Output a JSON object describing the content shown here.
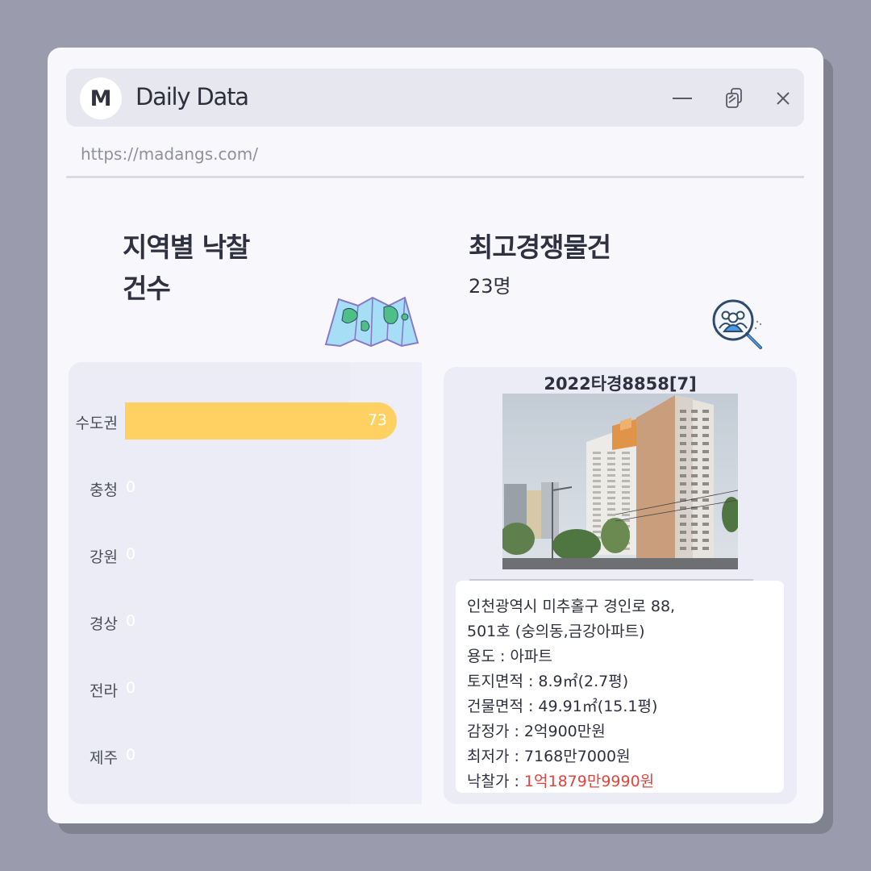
{
  "window": {
    "logo": "M",
    "title": "Daily Data",
    "url": "https://madangs.com/",
    "controls": [
      "minimize-icon",
      "restore-icon",
      "close-icon"
    ]
  },
  "left_card": {
    "title_line1": "지역별 낙찰",
    "title_line2": "건수",
    "icon": "map-icon",
    "chart_data": {
      "type": "bar",
      "orientation": "horizontal",
      "categories": [
        "수도권",
        "충청",
        "강원",
        "경상",
        "전라",
        "제주"
      ],
      "values": [
        73,
        0,
        0,
        0,
        0,
        0
      ],
      "xlim": [
        0,
        73
      ]
    }
  },
  "right_card": {
    "title": "최고경쟁물건",
    "subtitle": "23명",
    "icon": "people-search-icon",
    "case_no": "2022타경8858[7]",
    "photo": "apartment-building-photo",
    "address_line1": "인천광역시 미추홀구 경인로 88,",
    "address_line2": "501호 (숭의동,금강아파트)",
    "usage_label": "용도 : ",
    "usage_value": "아파트",
    "land_label": "토지면적 : ",
    "land_value": "8.9㎡(2.7평)",
    "building_label": "건물면적 : ",
    "building_value": "49.91㎡(15.1평)",
    "appraisal_label": "감정가 : ",
    "appraisal_value": "2억900만원",
    "minimum_label": "최저가 : ",
    "minimum_value": "7168만7000원",
    "winning_label": "낙찰가 : ",
    "winning_value": "1억1879만9990원",
    "winning_color": "#e0453e"
  }
}
